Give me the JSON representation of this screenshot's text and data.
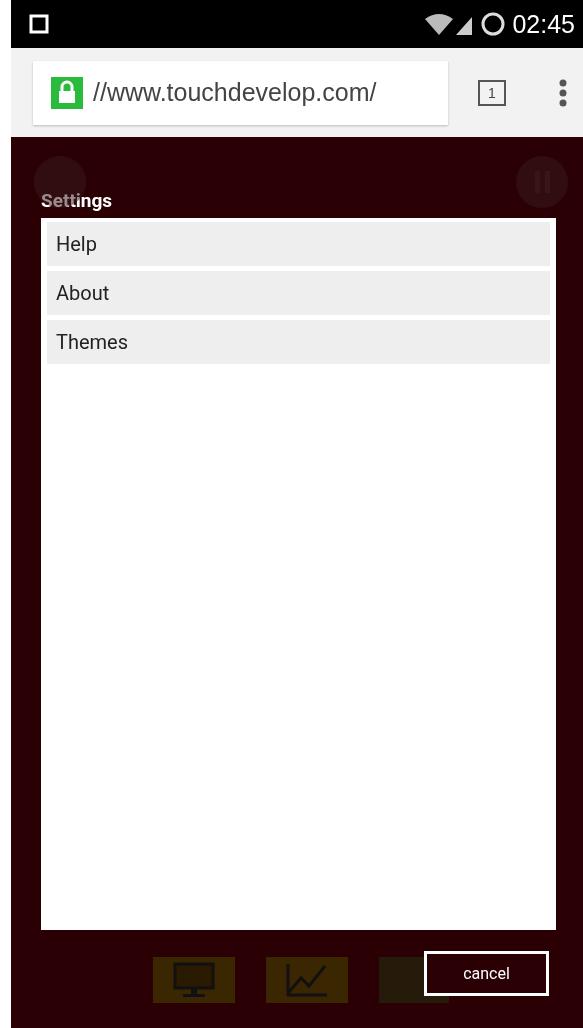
{
  "status_bar": {
    "time": "02:45"
  },
  "browser": {
    "url": "//www.touchdevelop.com/",
    "tab_count": "1"
  },
  "dialog": {
    "title": "Settings",
    "items": [
      {
        "label": "Help"
      },
      {
        "label": "About"
      },
      {
        "label": "Themes"
      }
    ],
    "cancel_button": "cancel"
  }
}
